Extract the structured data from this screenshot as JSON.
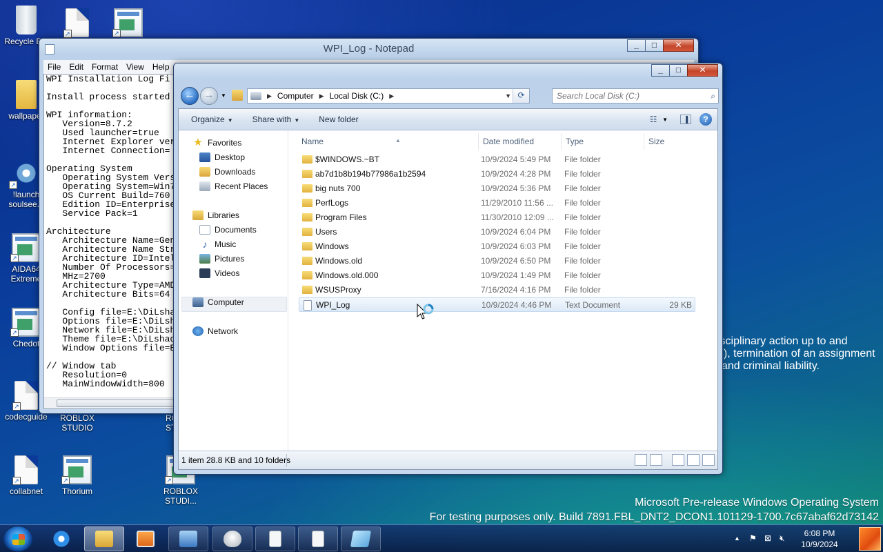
{
  "desktop": {
    "icons": [
      {
        "label": "Recycle Bin"
      },
      {
        "label": "wallpaper"
      },
      {
        "label": "!launch soulsee..."
      },
      {
        "label": "AIDA64 Extreme"
      },
      {
        "label": "Chedot"
      },
      {
        "label": "codecguide"
      },
      {
        "label": "collabnet"
      },
      {
        "label": "ROBLOX STUDIO"
      },
      {
        "label": "Thorium"
      },
      {
        "label": "ROBLOX STUDI..."
      },
      {
        "label": "RO... STU..."
      }
    ],
    "banner_lines": [
      "isciplinary action up to and",
      "es), termination of an assignment",
      "and criminal liability."
    ],
    "watermark_line1": "Microsoft Pre-release Windows Operating System",
    "watermark_line2": "For testing purposes only. Build 7891.FBL_DNT2_DCON1.101129-1700.7c67abaf62d73142"
  },
  "notepad": {
    "title": "WPI_Log - Notepad",
    "menu": [
      "File",
      "Edit",
      "Format",
      "View",
      "Help"
    ],
    "lines": [
      "WPI Installation Log Fi",
      "",
      "Install process started",
      "",
      "WPI information:",
      "   Version=8.7.2",
      "   Used launcher=true",
      "   Internet Explorer ver",
      "   Internet Connection=",
      "",
      "Operating System",
      "   Operating System Vers",
      "   Operating System=Win7",
      "   OS Current Build=760",
      "   Edition ID=Enterprise",
      "   Service Pack=1",
      "",
      "Architecture",
      "   Architecture Name=Gen",
      "   Architecture Name Str",
      "   Architecture ID=Intel",
      "   Number Of Processors=",
      "   MHz=2700",
      "   Architecture Type=AMD",
      "   Architecture Bits=64",
      "",
      "   Config file=E:\\DiLsha",
      "   Options file=E:\\DiLsh",
      "   Network file=E:\\DiLsh",
      "   Theme file=E:\\DiLshad",
      "   Window Options file=E",
      "",
      "// Window tab",
      "   Resolution=0",
      "   MainWindowWidth=800"
    ]
  },
  "explorer": {
    "address": {
      "crumbs": [
        "Computer",
        "Local Disk (C:)"
      ]
    },
    "search": {
      "placeholder": "Search Local Disk (C:)"
    },
    "commands": {
      "organize": "Organize",
      "share": "Share with",
      "new_folder": "New folder"
    },
    "nav": {
      "favorites": "Favorites",
      "desktop": "Desktop",
      "downloads": "Downloads",
      "recent": "Recent Places",
      "libraries": "Libraries",
      "documents": "Documents",
      "music": "Music",
      "pictures": "Pictures",
      "videos": "Videos",
      "computer": "Computer",
      "network": "Network"
    },
    "columns": {
      "name": "Name",
      "date": "Date modified",
      "type": "Type",
      "size": "Size"
    },
    "files": [
      {
        "name": "$WINDOWS.~BT",
        "date": "10/9/2024 5:49 PM",
        "type": "File folder",
        "size": ""
      },
      {
        "name": "ab7d1b8b194b77986a1b2594",
        "date": "10/9/2024 4:28 PM",
        "type": "File folder",
        "size": ""
      },
      {
        "name": "big nuts 700",
        "date": "10/9/2024 5:36 PM",
        "type": "File folder",
        "size": ""
      },
      {
        "name": "PerfLogs",
        "date": "11/29/2010 11:56 ...",
        "type": "File folder",
        "size": ""
      },
      {
        "name": "Program Files",
        "date": "11/30/2010 12:09 ...",
        "type": "File folder",
        "size": ""
      },
      {
        "name": "Users",
        "date": "10/9/2024 6:04 PM",
        "type": "File folder",
        "size": ""
      },
      {
        "name": "Windows",
        "date": "10/9/2024 6:03 PM",
        "type": "File folder",
        "size": ""
      },
      {
        "name": "Windows.old",
        "date": "10/9/2024 6:50 PM",
        "type": "File folder",
        "size": ""
      },
      {
        "name": "Windows.old.000",
        "date": "10/9/2024 1:49 PM",
        "type": "File folder",
        "size": ""
      },
      {
        "name": "WSUSProxy",
        "date": "7/16/2024 4:16 PM",
        "type": "File folder",
        "size": ""
      },
      {
        "name": "WPI_Log",
        "date": "10/9/2024 4:46 PM",
        "type": "Text Document",
        "size": "29 KB"
      }
    ],
    "status": "1 item 28.8 KB and 10 folders"
  },
  "taskbar": {
    "clock_time": "6:08 PM",
    "clock_date": "10/9/2024"
  }
}
